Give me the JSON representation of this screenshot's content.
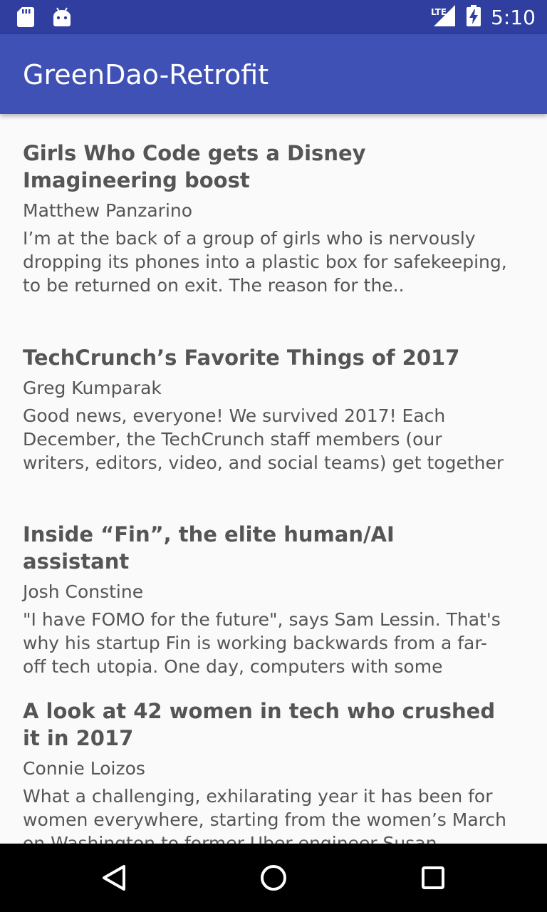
{
  "status_bar": {
    "time": "5:10",
    "network": "LTE",
    "icons": [
      "sd-card-icon",
      "android-icon",
      "lte-signal-icon",
      "battery-charging-icon"
    ]
  },
  "app_bar": {
    "title": "GreenDao-Retrofit",
    "color": "#3f51b5",
    "status_color": "#303f9f"
  },
  "articles": [
    {
      "title": "Girls Who Code gets a Disney Imagineering boost",
      "author": "Matthew Panzarino",
      "description": "I’m at the back of a group of girls who is nervously dropping its phones into a plastic box for safekeeping, to be returned on exit. The reason for the.."
    },
    {
      "title": "TechCrunch’s Favorite Things of 2017",
      "author": "Greg Kumparak",
      "description": "Good news, everyone! We survived 2017! Each December, the TechCrunch staff members (our writers, editors, video, and social teams) get together"
    },
    {
      "title": "Inside “Fin”, the elite human/AI assistant",
      "author": "Josh Constine",
      "description": "\"I have FOMO for the future\", says Sam Lessin. That's why his startup Fin is working backwards from a far-off tech utopia. One day, computers with some"
    },
    {
      "title": "A look at 42 women in tech who crushed it in 2017",
      "author": "Connie Loizos",
      "description": "What a challenging, exhilarating year it has been for women everywhere, starting from the women’s March on Washington to former Uber engineer Susan"
    }
  ],
  "nav_bar": {
    "buttons": [
      "back-icon",
      "home-icon",
      "recents-icon"
    ]
  }
}
